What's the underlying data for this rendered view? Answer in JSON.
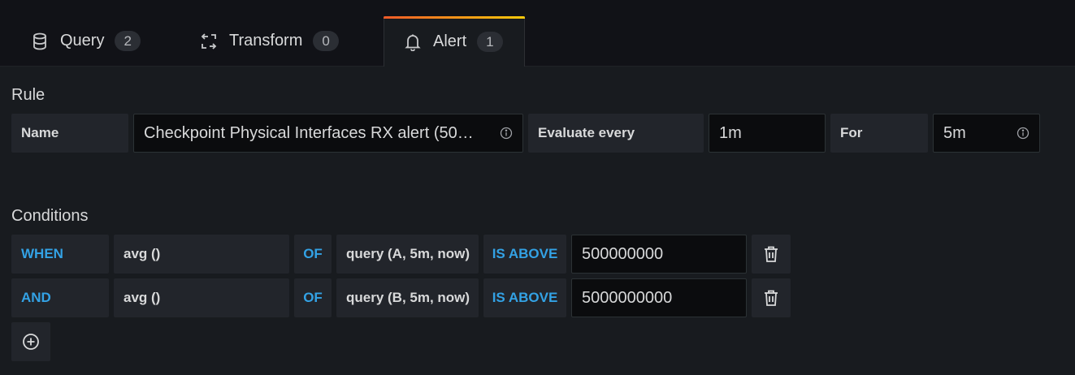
{
  "tabs": [
    {
      "label": "Query",
      "count": "2",
      "icon": "database-icon"
    },
    {
      "label": "Transform",
      "count": "0",
      "icon": "transform-icon"
    },
    {
      "label": "Alert",
      "count": "1",
      "icon": "bell-icon",
      "active": true
    }
  ],
  "rule": {
    "section_title": "Rule",
    "name_label": "Name",
    "name_value": "Checkpoint Physical Interfaces RX alert (50…",
    "evaluate_label": "Evaluate every",
    "evaluate_value": "1m",
    "for_label": "For",
    "for_value": "5m"
  },
  "conditions": {
    "section_title": "Conditions",
    "rows": [
      {
        "operator": "WHEN",
        "reducer": "avg ()",
        "of": "OF",
        "query": "query (A, 5m, now)",
        "evaluator": "IS ABOVE",
        "threshold": "500000000"
      },
      {
        "operator": "AND",
        "reducer": "avg ()",
        "of": "OF",
        "query": "query (B, 5m, now)",
        "evaluator": "IS ABOVE",
        "threshold": "5000000000"
      }
    ]
  },
  "colors": {
    "accent": "#33a2e5",
    "tab_gradient_start": "#f05a28",
    "tab_gradient_end": "#fbca0a"
  }
}
